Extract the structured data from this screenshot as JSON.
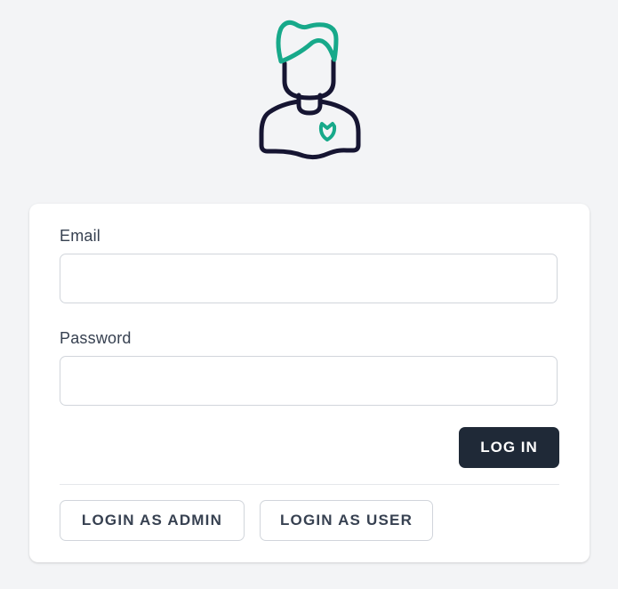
{
  "logo": {
    "icon": "user-avatar-icon",
    "outline_color": "#161532",
    "accent_color": "#17a98a"
  },
  "form": {
    "email_label": "Email",
    "email_value": "",
    "email_placeholder": "",
    "password_label": "Password",
    "password_value": "",
    "password_placeholder": "",
    "submit_label": "LOG IN"
  },
  "quick_login": {
    "admin_label": "LOGIN AS ADMIN",
    "user_label": "LOGIN AS USER"
  },
  "colors": {
    "background": "#f3f4f6",
    "card": "#ffffff",
    "primary_button": "#1f2937",
    "text": "#374151",
    "border": "#d1d5db"
  }
}
